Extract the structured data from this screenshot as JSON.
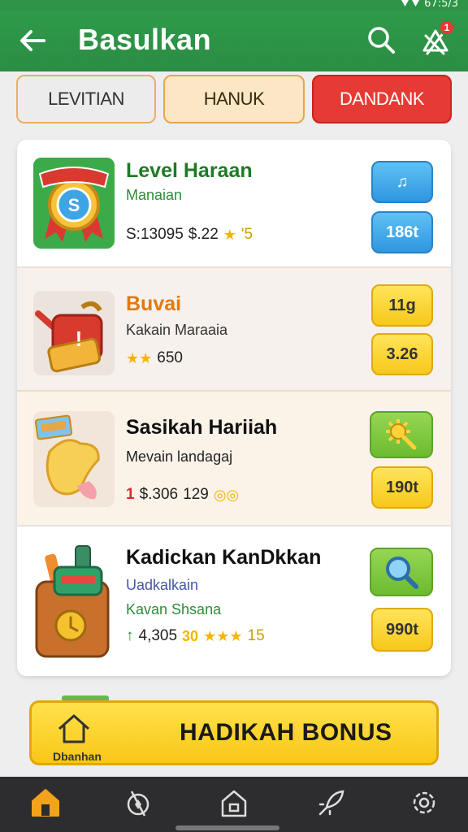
{
  "status_bar": {
    "time": "67:5/3"
  },
  "app_bar": {
    "title": "Basulkan",
    "notification_count": "1",
    "icons": [
      "arrow-left-icon",
      "search-icon",
      "notification-icon"
    ]
  },
  "tabs": [
    {
      "label": "LEVITIAN"
    },
    {
      "label": "HANUK"
    },
    {
      "label": "DANDANK"
    }
  ],
  "items": [
    {
      "title": "Level Haraan",
      "subtitle": "Manaian",
      "meta_text": "S:13095",
      "meta_value": "$.22",
      "rating": "'5",
      "button_top": "♫",
      "button_bottom": "186t",
      "icon": "badge-medal-icon",
      "title_color": "#1f7a25"
    },
    {
      "title": "Buvai",
      "subtitle": "Kakain Maraaia",
      "meta_value": "650",
      "button_top": "11g",
      "button_bottom": "3.26",
      "icon": "fuel-can-icon",
      "title_color": "#e07a10"
    },
    {
      "title": "Sasikah Hariiah",
      "subtitle": "Mevain landagaj",
      "meta_rank": "1",
      "meta_text": "$.306",
      "meta_value": "129",
      "button_top": "gear-icon",
      "button_bottom": "190t",
      "icon": "sweet-treat-icon"
    },
    {
      "title": "Kadickan KanDkkan",
      "subtitle": "Uadkalkain",
      "subtitle2": "Kavan Shsana",
      "meta_text": "4,305",
      "meta_value": "30",
      "rating": "15",
      "button_top": "magnifier-icon",
      "button_bottom": "990t",
      "icon": "backpack-icon"
    }
  ],
  "bonus": {
    "label": "HADIKAH BONUS",
    "icon_label": "Dbanhan"
  },
  "bottom_nav": [
    "home-icon",
    "compass-icon",
    "shop-icon",
    "rocket-icon",
    "settings-icon"
  ],
  "colors": {
    "primary": "#2e9447",
    "accent_red": "#e53b34",
    "bonus_yellow": "#f9c716"
  }
}
